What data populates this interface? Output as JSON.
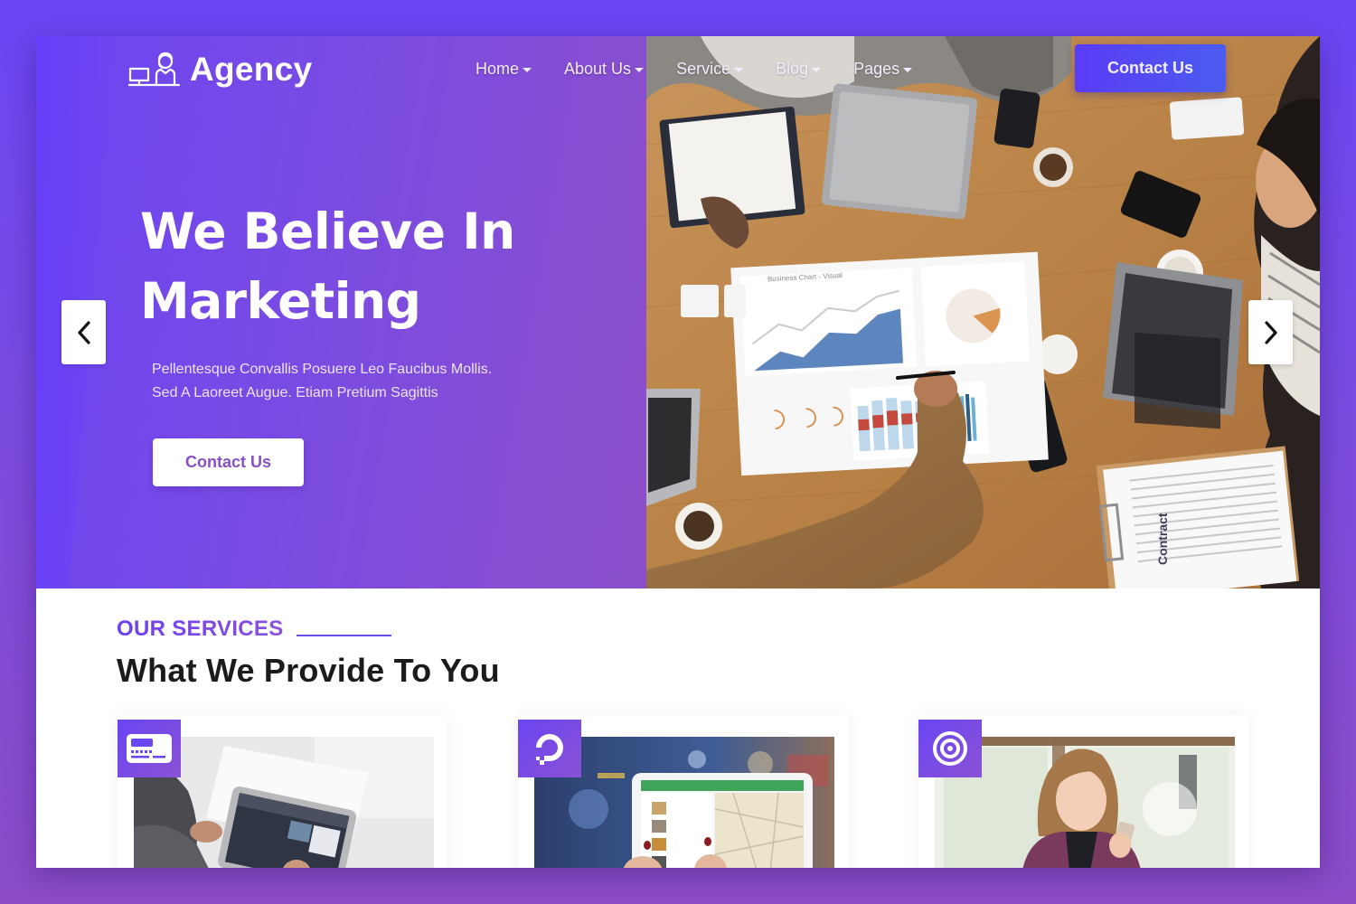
{
  "brand": {
    "name": "Agency",
    "logo_icon": "computer-support-agent-icon"
  },
  "nav": {
    "items": [
      {
        "label": "Home",
        "has_dropdown": true
      },
      {
        "label": "About Us",
        "has_dropdown": true
      },
      {
        "label": "Service",
        "has_dropdown": true
      },
      {
        "label": "Blog",
        "has_dropdown": true
      },
      {
        "label": "Pages",
        "has_dropdown": true
      }
    ],
    "cta_label": "Contact Us"
  },
  "hero": {
    "title_line1": "We Believe In",
    "title_line2": "Marketing",
    "description_line1": "Pellentesque Convallis Posuere Leo Faucibus Mollis.",
    "description_line2": "Sed A Laoreet Augue. Etiam Pretium Sagittis",
    "button_label": "Contact Us",
    "prev_icon": "chevron-left-icon",
    "next_icon": "chevron-right-icon",
    "photo_description": "Team meeting around a wooden table with laptops, charts, coffee cups and a clipboard",
    "photo_texts": {
      "chart_sheet_title": "Business Chart - Visual",
      "clipboard_label": "Contract"
    }
  },
  "services": {
    "eyebrow": "OUR SERVICES",
    "title": "What We Provide To You",
    "cards": [
      {
        "icon": "card-payment-icon",
        "image": "Person using a tablet at a desk"
      },
      {
        "icon": "digitalocean-icon",
        "image": "Hands holding a tablet showing a map"
      },
      {
        "icon": "target-icon",
        "image": "Woman smiling at her smartphone"
      }
    ]
  },
  "colors": {
    "accent": "#6b45f3",
    "accent_secondary": "#8c4fc9",
    "cta_blue": "#4b5cf0",
    "heading_dark": "#1b1b1b"
  }
}
